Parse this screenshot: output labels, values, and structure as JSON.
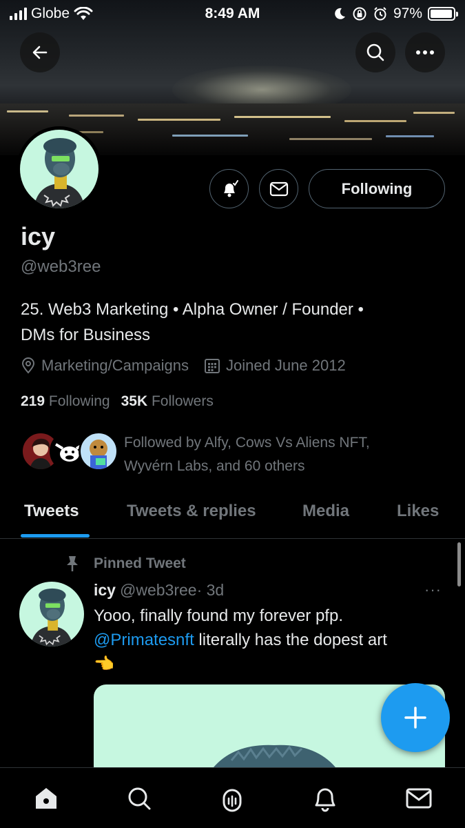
{
  "status_bar": {
    "carrier": "Globe",
    "time": "8:49 AM",
    "battery_percent": "97%",
    "battery_level": 0.97
  },
  "header": {
    "back_icon": "back-arrow-icon",
    "search_icon": "search-icon",
    "more_icon": "more-icon"
  },
  "profile": {
    "name": "icy",
    "handle": "@web3ree",
    "bio_line1": "25. Web3 Marketing • Alpha Owner / Founder •",
    "bio_line2": "DMs for Business",
    "location": "Marketing/Campaigns",
    "joined": "Joined June 2012",
    "following_count": "219",
    "following_label": "Following",
    "followers_count": "35K",
    "followers_label": "Followers",
    "followed_by_line1": "Followed by Alfy, Cows Vs Aliens NFT,",
    "followed_by_line2": "Wyvérn Labs, and 60 others",
    "following_button": "Following"
  },
  "tabs": [
    "Tweets",
    "Tweets & replies",
    "Media",
    "Likes"
  ],
  "active_tab": "Tweets",
  "pinned_tweet": {
    "pinned_label": "Pinned Tweet",
    "author_name": "icy",
    "author_handle": "@web3ree",
    "time": "· 3d",
    "more": "···",
    "text_line1": "Yooo, finally found my forever pfp.",
    "mention": "@Primatesnft",
    "text_line2_rest": " literally has the dopest art",
    "emoji": "👈"
  },
  "colors": {
    "accent": "#1d9bf0",
    "background": "#000000",
    "secondary_text": "#71767b",
    "avatar_bg": "#c6f7e0"
  },
  "bottom_nav": [
    "home-icon",
    "search-icon",
    "spaces-icon",
    "notifications-icon",
    "messages-icon"
  ]
}
